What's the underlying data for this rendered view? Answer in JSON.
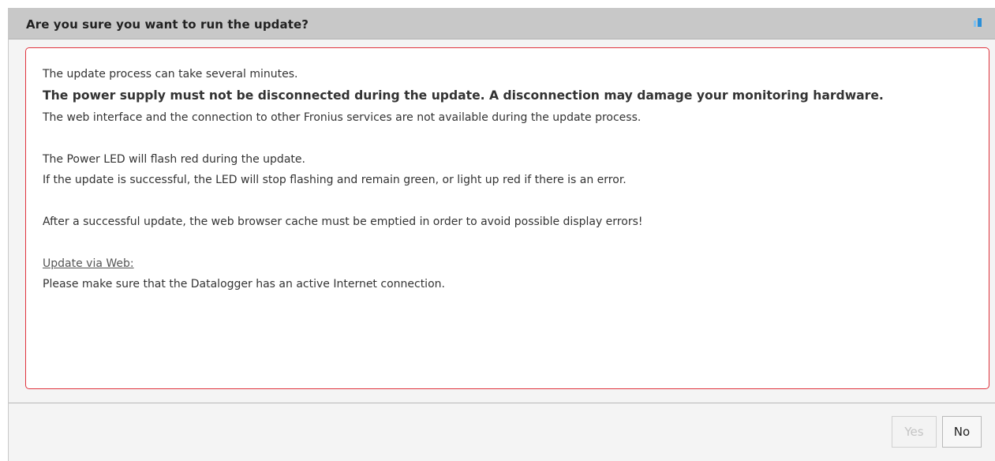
{
  "dialog": {
    "title": "Are you sure you want to run the update?",
    "resize_icon": "window-resize-icon"
  },
  "message": {
    "line1": "The update process can take several minutes.",
    "warning": "The power supply must not be disconnected during the update. A disconnection may damage your monitoring hardware.",
    "line3": "The web interface and the connection to other Fronius services are not available during the update process.",
    "line4": "The Power LED will flash red during the update.",
    "line5": "If the update is successful, the LED will stop flashing and remain green, or light up red if there is an error.",
    "line6": "After a successful update, the web browser cache must be emptied in order to avoid possible display errors!",
    "web_heading": "Update via Web:",
    "line8": "Please make sure that the Datalogger has an active Internet connection."
  },
  "buttons": {
    "yes_label": "Yes",
    "yes_disabled": true,
    "no_label": "No"
  },
  "colors": {
    "border_accent": "#e0333d",
    "titlebar": "#c8c8c8"
  }
}
